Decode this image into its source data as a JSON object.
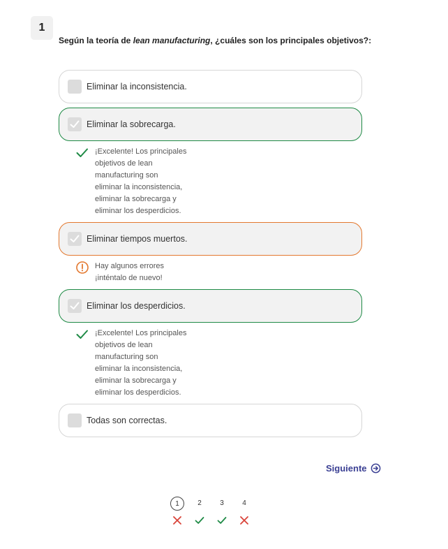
{
  "question": {
    "number": "1",
    "prefix": "Según la teoría de ",
    "emphasis": "lean manufacturing",
    "suffix": ", ¿cuáles son los principales objetivos?:"
  },
  "options": [
    {
      "label": "Eliminar la inconsistencia.",
      "selected": false,
      "status": "none"
    },
    {
      "label": "Eliminar la sobrecarga.",
      "selected": true,
      "status": "correct",
      "feedback": "¡Excelente! Los principales\nobjetivos de lean\nmanufacturing son\neliminar la inconsistencia,\neliminar la sobrecarga y\neliminar los desperdicios."
    },
    {
      "label": "Eliminar tiempos muertos.",
      "selected": true,
      "status": "wrong",
      "feedback": "Hay algunos errores\n¡inténtalo de nuevo!"
    },
    {
      "label": "Eliminar los desperdicios.",
      "selected": true,
      "status": "correct",
      "feedback": "¡Excelente! Los principales\nobjetivos de lean\nmanufacturing son\neliminar la inconsistencia,\neliminar la sobrecarga y\neliminar los desperdicios."
    },
    {
      "label": "Todas son correctas.",
      "selected": false,
      "status": "none"
    }
  ],
  "next_label": "Siguiente",
  "pager": [
    {
      "num": "1",
      "current": true,
      "result": "wrong"
    },
    {
      "num": "2",
      "current": false,
      "result": "correct"
    },
    {
      "num": "3",
      "current": false,
      "result": "correct"
    },
    {
      "num": "4",
      "current": false,
      "result": "wrong"
    }
  ],
  "colors": {
    "correct": "#1e8a45",
    "wrong_border": "#e3782f",
    "wrong_mark": "#d9443a",
    "accent": "#3a3f93"
  }
}
